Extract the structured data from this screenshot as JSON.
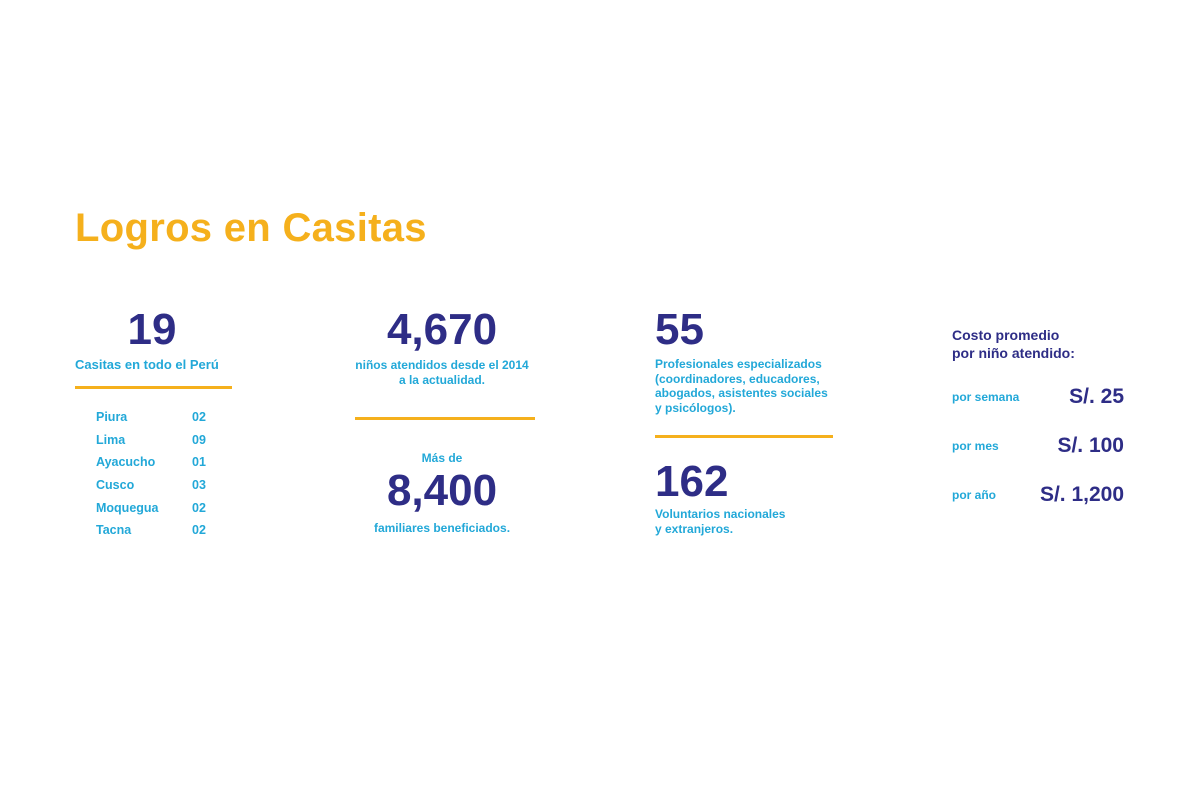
{
  "title": "Logros en Casitas",
  "colors": {
    "accent": "#F5B01C",
    "number": "#2E2D86",
    "label": "#22A8D8"
  },
  "casitas": {
    "number": "19",
    "label": "Casitas en todo el Perú",
    "cities": [
      {
        "name": "Piura",
        "count": "02"
      },
      {
        "name": "Lima",
        "count": "09"
      },
      {
        "name": "Ayacucho",
        "count": "01"
      },
      {
        "name": "Cusco",
        "count": "03"
      },
      {
        "name": "Moquegua",
        "count": "02"
      },
      {
        "name": "Tacna",
        "count": "02"
      }
    ]
  },
  "ninos": {
    "number": "4,670",
    "desc_line1": "niños atendidos desde el 2014",
    "desc_line2": "a la actualidad."
  },
  "familiares": {
    "prefix": "Más de",
    "number": "8,400",
    "desc": "familiares beneficiados."
  },
  "profesionales": {
    "number": "55",
    "desc_lines": [
      "Profesionales especializados",
      "(coordinadores, educadores,",
      "abogados, asistentes sociales",
      "y psicólogos)."
    ]
  },
  "voluntarios": {
    "number": "162",
    "desc_lines": [
      "Voluntarios nacionales",
      "y extranjeros."
    ]
  },
  "costo": {
    "title_line1": "Costo promedio",
    "title_line2": "por niño atendido:",
    "semana": {
      "label": "por semana",
      "value": "S/. 25"
    },
    "mes": {
      "label": "por mes",
      "value": "S/. 100"
    },
    "anio": {
      "label": "por año",
      "value": "S/. 1,200"
    }
  }
}
